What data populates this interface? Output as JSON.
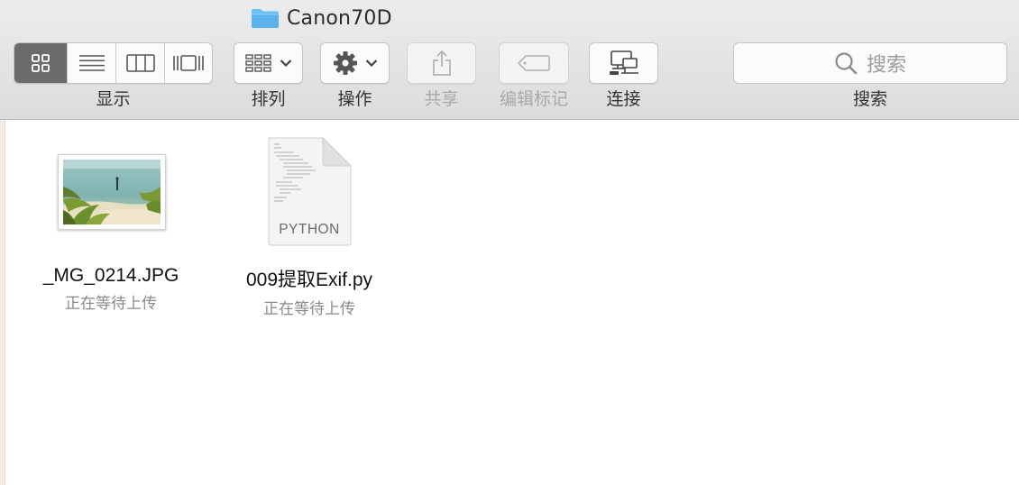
{
  "window": {
    "title": "Canon70D",
    "title_icon": "folder-icon"
  },
  "toolbar": {
    "view_group": {
      "label": "显示",
      "options": [
        {
          "name": "icon-view",
          "icon": "grid-icon",
          "selected": true
        },
        {
          "name": "list-view",
          "icon": "list-icon",
          "selected": false
        },
        {
          "name": "column-view",
          "icon": "columns-icon",
          "selected": false
        },
        {
          "name": "gallery-view",
          "icon": "gallery-icon",
          "selected": false
        }
      ]
    },
    "arrange": {
      "label": "排列",
      "icon": "arrange-grid-icon",
      "has_dropdown": true
    },
    "action": {
      "label": "操作",
      "icon": "gear-icon",
      "has_dropdown": true
    },
    "share": {
      "label": "共享",
      "icon": "share-icon",
      "enabled": false
    },
    "tags": {
      "label": "编辑标记",
      "icon": "tag-icon",
      "enabled": false
    },
    "connect": {
      "label": "连接",
      "icon": "connect-server-icon",
      "enabled": true
    },
    "search": {
      "label": "搜索",
      "placeholder": "搜索",
      "icon": "search-icon"
    }
  },
  "files": [
    {
      "name": "_MG_0214.JPG",
      "status": "正在等待上传",
      "kind": "image-thumbnail"
    },
    {
      "name": "009提取Exif.py",
      "status": "正在等待上传",
      "kind": "document",
      "doc_type_label": "PYTHON"
    }
  ],
  "colors": {
    "toolbar_bg": "#e4e4e4",
    "selected_segment": "#6b6b6b",
    "folder_blue": "#5fb8f0",
    "status_gray": "#8a8a8a"
  }
}
